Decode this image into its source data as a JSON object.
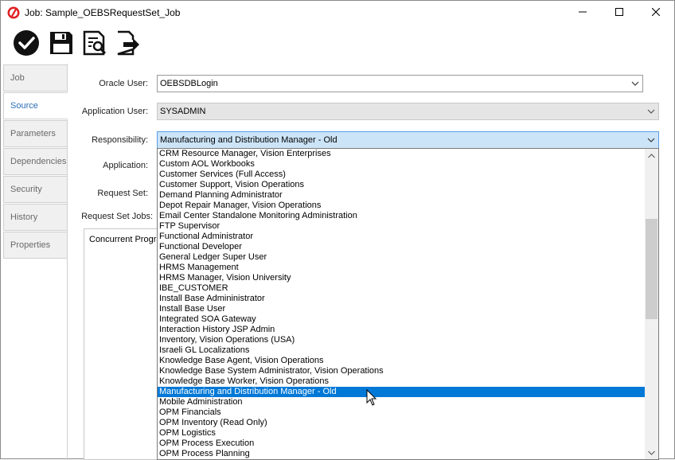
{
  "window": {
    "title": "Job: Sample_OEBSRequestSet_Job"
  },
  "toolbar": {
    "buttons": [
      "check-icon",
      "save-icon",
      "report-icon",
      "export-icon"
    ]
  },
  "tabs": [
    {
      "label": "Job"
    },
    {
      "label": "Source"
    },
    {
      "label": "Parameters"
    },
    {
      "label": "Dependencies"
    },
    {
      "label": "Security"
    },
    {
      "label": "History"
    },
    {
      "label": "Properties"
    }
  ],
  "form": {
    "oracle_user": {
      "label": "Oracle User:",
      "value": "OEBSDBLogin"
    },
    "application_user": {
      "label": "Application User:",
      "value": "SYSADMIN"
    },
    "responsibility": {
      "label": "Responsibility:",
      "value": "Manufacturing and Distribution Manager - Old"
    },
    "application": {
      "label": "Application:"
    },
    "request_set": {
      "label": "Request Set:"
    },
    "request_set_jobs": {
      "label": "Request Set Jobs:",
      "column_header": "Concurrent Progra"
    }
  },
  "dropdown": {
    "items": [
      "CRM Resource Manager, Vision Enterprises",
      "Custom AOL Workbooks",
      "Customer Services (Full Access)",
      "Customer Support, Vision Operations",
      "Demand Planning Administrator",
      "Depot Repair Manager, Vision Operations",
      "Email Center Standalone Monitoring Administration",
      "FTP Supervisor",
      "Functional Administrator",
      "Functional Developer",
      "General Ledger Super User",
      "HRMS Management",
      "HRMS Manager, Vision University",
      "IBE_CUSTOMER",
      "Install Base Admininistrator",
      "Install Base User",
      "Integrated SOA Gateway",
      "Interaction History JSP Admin",
      "Inventory, Vision Operations (USA)",
      "Israeli GL Localizations",
      "Knowledge Base Agent, Vision Operations",
      "Knowledge Base System Administrator, Vision Operations",
      "Knowledge Base Worker, Vision Operations",
      "Manufacturing and Distribution Manager - Old",
      "Mobile Administration",
      "OPM Financials",
      "OPM Inventory (Read Only)",
      "OPM Logistics",
      "OPM Process Execution",
      "OPM Process Planning"
    ],
    "selected": "Manufacturing and Distribution Manager - Old"
  },
  "colors": {
    "accent": "#0078d7",
    "active_tab_text": "#2a6fb5",
    "focused_combo": "#cce4f7"
  }
}
